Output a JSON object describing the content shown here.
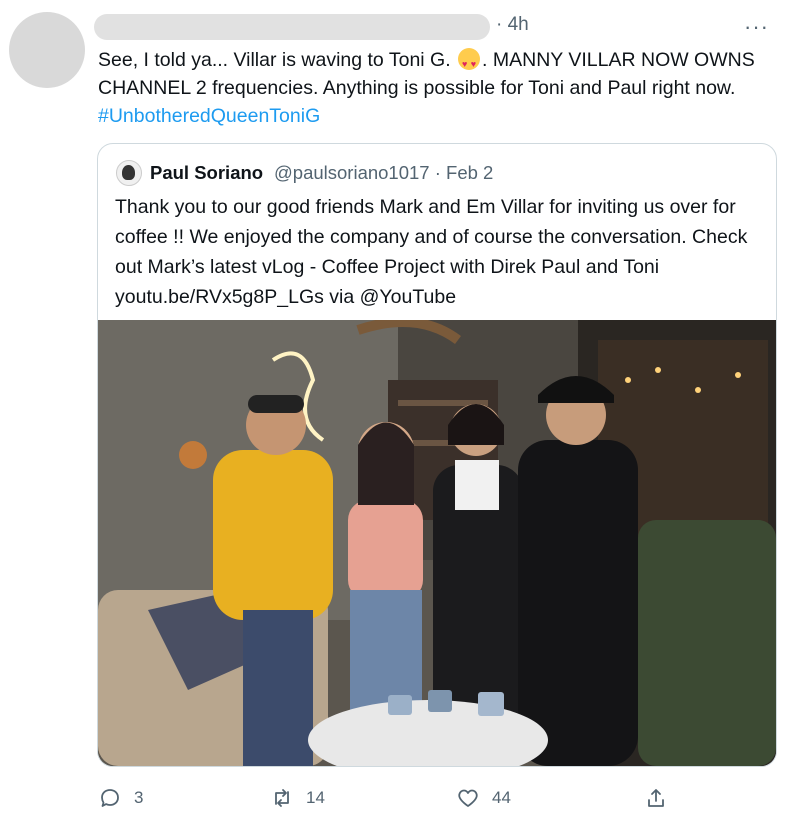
{
  "tweet": {
    "time": "· 4h",
    "more": "···",
    "text_part1": "See, I told ya... Villar is waving to Toni G. ",
    "text_part2": ". MANNY VILLAR NOW OWNS CHANNEL 2 frequencies. Anything is possible for Toni and Paul right now.",
    "hashtag": "#UnbotheredQueenToniG"
  },
  "quote": {
    "name": "Paul Soriano",
    "handle": "@paulsoriano1017 · Feb 2",
    "text": "Thank you to our good friends Mark and Em Villar for inviting us over for coffee !! We enjoyed the company and of course the conversation. Check out Mark’s latest vLog - Coffee Project with Direk Paul and Toni youtu.be/RVx5g8P_LGs via @YouTube"
  },
  "actions": {
    "replies": "3",
    "retweets": "14",
    "likes": "44"
  },
  "colors": {
    "link": "#1d9bf0",
    "secondary_text": "#536471",
    "border": "#cfd9de"
  }
}
